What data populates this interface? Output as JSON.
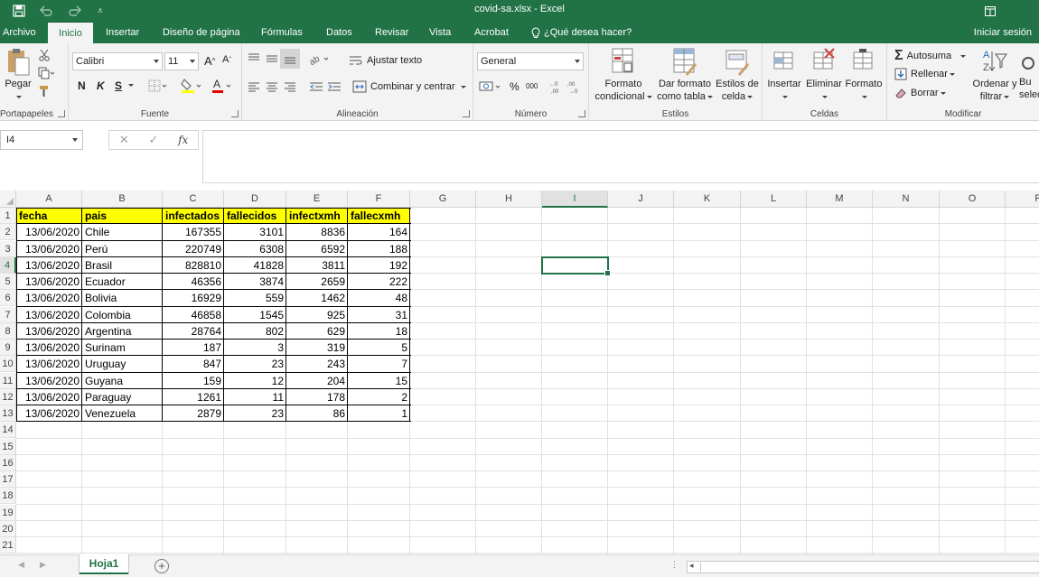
{
  "titlebar": {
    "title": "covid-sa.xlsx - Excel",
    "save_icon": "save-icon",
    "undo_icon": "undo-icon",
    "redo_icon": "redo-icon"
  },
  "tabs": {
    "archivo": "Archivo",
    "inicio": "Inicio",
    "insertar": "Insertar",
    "diseno": "Diseño de página",
    "formulas": "Fórmulas",
    "datos": "Datos",
    "revisar": "Revisar",
    "vista": "Vista",
    "acrobat": "Acrobat",
    "tellme": "¿Qué desea hacer?",
    "signin": "Iniciar sesión"
  },
  "ribbon": {
    "clipboard": {
      "paste": "Pegar",
      "label": "Portapapeles"
    },
    "font": {
      "name": "Calibri",
      "size": "11",
      "grow": "A",
      "shrink": "A",
      "bold": "N",
      "italic": "K",
      "underline": "S",
      "label": "Fuente"
    },
    "alignment": {
      "wrap": "Ajustar texto",
      "merge": "Combinar y centrar",
      "label": "Alineación"
    },
    "number": {
      "format": "General",
      "percent": "%",
      "thousands": "000",
      "label": "Número"
    },
    "styles": {
      "conditional": [
        "Formato",
        "condicional"
      ],
      "as_table": [
        "Dar formato",
        "como tabla"
      ],
      "cell_styles": [
        "Estilos de",
        "celda"
      ],
      "label": "Estilos"
    },
    "cells": {
      "insert": "Insertar",
      "delete": "Eliminar",
      "format": "Formato",
      "label": "Celdas"
    },
    "editing": {
      "autosum": "Autosuma",
      "fill": "Rellenar",
      "clear": "Borrar",
      "sort": [
        "Ordenar y",
        "filtrar"
      ],
      "find": [
        "Bu",
        "selec"
      ],
      "label": "Modificar"
    }
  },
  "formula_bar": {
    "name_box": "I4",
    "cancel": "✕",
    "enter": "✓",
    "fx": "fx",
    "value": ""
  },
  "columns": [
    "A",
    "B",
    "C",
    "D",
    "E",
    "F",
    "G",
    "H",
    "I",
    "J",
    "K",
    "L",
    "M",
    "N",
    "O",
    "P"
  ],
  "rows": [
    "1",
    "2",
    "3",
    "4",
    "5",
    "6",
    "7",
    "8",
    "9",
    "10",
    "11",
    "12",
    "13",
    "14",
    "15",
    "16",
    "17",
    "18",
    "19",
    "20",
    "21"
  ],
  "selected_cell": "I4",
  "table": {
    "headers": [
      "fecha",
      "pais",
      "infectados",
      "fallecidos",
      "infectxmh",
      "fallecxmh"
    ],
    "rows": [
      [
        "13/06/2020",
        "Chile",
        "167355",
        "3101",
        "8836",
        "164"
      ],
      [
        "13/06/2020",
        "Perú",
        "220749",
        "6308",
        "6592",
        "188"
      ],
      [
        "13/06/2020",
        "Brasil",
        "828810",
        "41828",
        "3811",
        "192"
      ],
      [
        "13/06/2020",
        "Ecuador",
        "46356",
        "3874",
        "2659",
        "222"
      ],
      [
        "13/06/2020",
        "Bolivia",
        "16929",
        "559",
        "1462",
        "48"
      ],
      [
        "13/06/2020",
        "Colombia",
        "46858",
        "1545",
        "925",
        "31"
      ],
      [
        "13/06/2020",
        "Argentina",
        "28764",
        "802",
        "629",
        "18"
      ],
      [
        "13/06/2020",
        "Surinam",
        "187",
        "3",
        "319",
        "5"
      ],
      [
        "13/06/2020",
        "Uruguay",
        "847",
        "23",
        "243",
        "7"
      ],
      [
        "13/06/2020",
        "Guyana",
        "159",
        "12",
        "204",
        "15"
      ],
      [
        "13/06/2020",
        "Paraguay",
        "1261",
        "11",
        "178",
        "2"
      ],
      [
        "13/06/2020",
        "Venezuela",
        "2879",
        "23",
        "86",
        "1"
      ]
    ]
  },
  "sheets": {
    "active": "Hoja1",
    "add": "+"
  },
  "colors": {
    "excel_green": "#217346",
    "header_fill": "#ffff00"
  }
}
